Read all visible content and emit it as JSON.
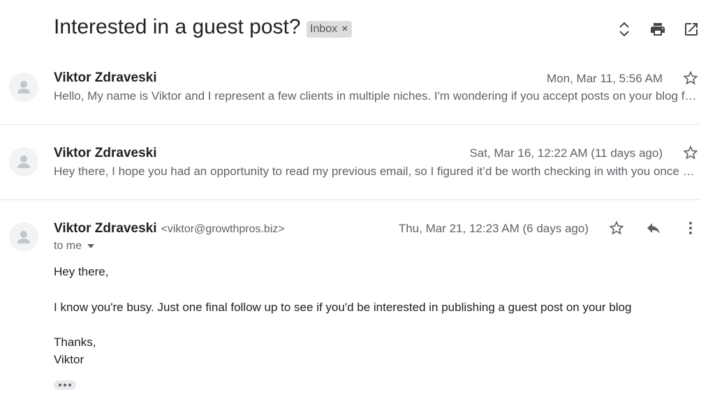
{
  "thread": {
    "subject": "Interested in a guest post?",
    "label": "Inbox",
    "label_remove": "×",
    "icons": [
      "expand-collapse-icon",
      "print-icon",
      "open-in-new-window-icon"
    ]
  },
  "messages": [
    {
      "sender": "Viktor Zdraveski",
      "date": "Mon, Mar 11, 5:56 AM",
      "snippet": "Hello, My name is Viktor and I represent a few clients in multiple niches. I'm wondering if you accept posts on your blog for publishing."
    },
    {
      "sender": "Viktor Zdraveski",
      "date": "Sat, Mar 16, 12:22 AM (11 days ago)",
      "snippet": "Hey there, I hope you had an opportunity to read my previous email, so I figured it’d be worth checking in with you once again."
    }
  ],
  "open_message": {
    "sender": "Viktor Zdraveski",
    "email": "<viktor@growthpros.biz>",
    "date": "Thu, Mar 21, 12:23 AM (6 days ago)",
    "to": "to me",
    "body": {
      "greeting": "Hey there,",
      "paragraph": "I know you're busy. Just one final follow up to see if you'd be interested in publishing a guest post on your blog",
      "signoff": "Thanks,",
      "signature": "Viktor"
    },
    "icons": [
      "star-icon",
      "reply-icon",
      "more-vert-icon"
    ]
  },
  "colors": {
    "text": "#202124",
    "secondary": "#5f6368",
    "chip": "#dddddd",
    "divider": "#e3e3e3"
  }
}
